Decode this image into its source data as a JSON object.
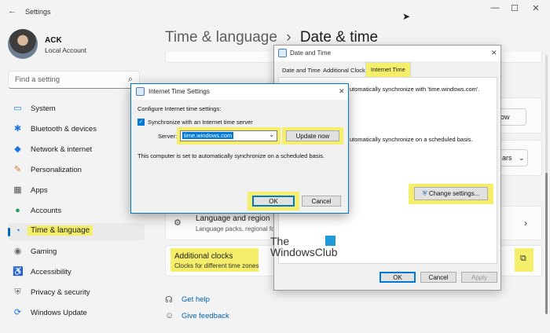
{
  "app": {
    "title": "Settings",
    "back": "←"
  },
  "window_controls": {
    "minimize": "—",
    "maximize": "☐",
    "close": "✕"
  },
  "user": {
    "name": "ACK",
    "account": "Local Account"
  },
  "search": {
    "placeholder": "Find a setting"
  },
  "sidebar": {
    "items": [
      {
        "label": "System",
        "icon": "system-icon",
        "glyph": "▭",
        "color": "#1a73e8"
      },
      {
        "label": "Bluetooth & devices",
        "icon": "bluetooth-icon",
        "glyph": "✱",
        "color": "#1a73e8"
      },
      {
        "label": "Network & internet",
        "icon": "network-icon",
        "glyph": "◆",
        "color": "#1a73e8"
      },
      {
        "label": "Personalization",
        "icon": "brush-icon",
        "glyph": "✎",
        "color": "#c97a2b"
      },
      {
        "label": "Apps",
        "icon": "apps-icon",
        "glyph": "▦",
        "color": "#555555"
      },
      {
        "label": "Accounts",
        "icon": "accounts-icon",
        "glyph": "●",
        "color": "#2d9d5f"
      },
      {
        "label": "Time & language",
        "icon": "clock-globe-icon",
        "glyph": "◔",
        "color": "#1a73e8",
        "active": true
      },
      {
        "label": "Gaming",
        "icon": "gaming-icon",
        "glyph": "◉",
        "color": "#666666"
      },
      {
        "label": "Accessibility",
        "icon": "accessibility-icon",
        "glyph": "♿",
        "color": "#1a73e8"
      },
      {
        "label": "Privacy & security",
        "icon": "shield-icon",
        "glyph": "⛨",
        "color": "#666666"
      },
      {
        "label": "Windows Update",
        "icon": "update-icon",
        "glyph": "⟳",
        "color": "#1a73e8"
      }
    ]
  },
  "main": {
    "breadcrumb_parent": "Time & language",
    "breadcrumb_sep": "›",
    "page_title": "Date & time",
    "partial_button": "ow",
    "partial_dropdown": "ars",
    "language_region": {
      "title": "Language and region",
      "subtitle": "Language packs, regional fo"
    },
    "additional_clocks": {
      "title": "Additional clocks",
      "subtitle": "Clocks for different time zones"
    },
    "get_help": "Get help",
    "give_feedback": "Give feedback"
  },
  "date_time_dialog": {
    "title": "Date and Time",
    "tabs": [
      "Date and Time",
      "Additional Clocks",
      "Internet Time"
    ],
    "active_tab": "Internet Time",
    "line1": "utomatically synchronize with 'time.windows.com'.",
    "line2": "utomatically synchronize on a scheduled basis.",
    "change_settings": "Change settings...",
    "ok": "OK",
    "cancel": "Cancel",
    "apply": "Apply"
  },
  "internet_time_dialog": {
    "title": "Internet Time Settings",
    "configure": "Configure Internet time settings:",
    "sync_label": "Synchronize with an Internet time server",
    "sync_checked": true,
    "server_label": "Server:",
    "server_value": "time.windows.com",
    "update_now": "Update now",
    "status": "This computer is set to automatically synchronize on a scheduled basis.",
    "ok": "OK",
    "cancel": "Cancel"
  },
  "watermark": {
    "line1": "The",
    "line2": "WindowsClub"
  },
  "colors": {
    "accent": "#0078d7",
    "highlight": "#f4ee6a"
  }
}
